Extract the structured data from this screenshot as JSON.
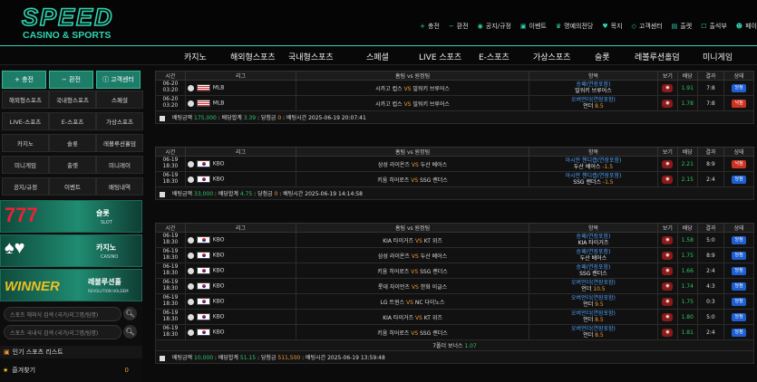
{
  "brand": {
    "logo_main": "SPEED",
    "logo_sub": "CASINO & SPORTS"
  },
  "top_menu": [
    {
      "icon": "+",
      "label": "충전"
    },
    {
      "icon": "−",
      "label": "환전"
    },
    {
      "icon": "◉",
      "label": "공지/규정"
    },
    {
      "icon": "▣",
      "label": "이벤트"
    },
    {
      "icon": "♛",
      "label": "명예의전당"
    },
    {
      "icon": "♥",
      "label": "목지"
    },
    {
      "icon": "◇",
      "label": "고객센터"
    },
    {
      "icon": "▤",
      "label": "출렛"
    },
    {
      "icon": "☐",
      "label": "출석부"
    },
    {
      "icon": "☻",
      "label": "페이"
    }
  ],
  "main_nav": [
    "카지노",
    "해외형스포츠",
    "국내형스포츠",
    "스페셜",
    "LIVE 스포츠",
    "E-스포츠",
    "가상스포츠",
    "슬롯",
    "레볼루션홀덤",
    "미니게임"
  ],
  "sidebar": {
    "buttons": [
      "+ 충전",
      "− 환전",
      "고객센터"
    ],
    "grid": [
      "해외형스포츠",
      "국내형스포츠",
      "스페셜",
      "LIVE-스포츠",
      "E-스포츠",
      "가상스포츠",
      "카지노",
      "슬롯",
      "레볼루션홀덤",
      "미니게임",
      "출렛",
      "미니레이",
      "공지/규정",
      "이벤트",
      "배팅내역"
    ],
    "banners": [
      {
        "img": "777",
        "title": "슬롯",
        "sub": "SLOT"
      },
      {
        "img": "♠♥",
        "title": "카지노",
        "sub": "CASINO"
      },
      {
        "img": "WINNER",
        "title": "레볼루션홀",
        "sub": "REVOLUTION HOLDEM"
      }
    ],
    "search1": "스포츠 해외식 검색 (국가/리그명/팀명)",
    "search2": "스포츠 국내식 검색 (국가/리그명/팀명)",
    "popular_title": "인기 스포츠 리스트",
    "favorites_label": "즐겨찾기",
    "favorites_count": "0"
  },
  "table_headers": [
    "시간",
    "리그",
    "홈팀 vs 원정팀",
    "항목",
    "보기",
    "배당",
    "결과",
    "상태"
  ],
  "bets": [
    {
      "rows": [
        {
          "date": "06-20",
          "time": "03:20",
          "flag": "us",
          "league": "MLB",
          "home": "시카고 컵스",
          "away": "밀워키 브루어스",
          "pick1": "승패(연장포함)",
          "pick2": "밀워키 브루어스",
          "pick2_odds": "",
          "odds": "1.91",
          "result": "7:8",
          "status": "당첨",
          "status_type": "pend"
        },
        {
          "date": "06-20",
          "time": "03:20",
          "flag": "us",
          "league": "MLB",
          "home": "시카고 컵스",
          "away": "밀워키 브루어스",
          "pick1": "오버언더(연장포함)",
          "pick2": "언더",
          "pick2_odds": "8.5",
          "odds": "1.78",
          "result": "7:8",
          "status": "낙첨",
          "status_type": "lose"
        }
      ],
      "summary": {
        "amount_label": "배팅금액",
        "amount": "175,000",
        "odds_label": "배당합계",
        "odds": "3.39",
        "win_label": "당첨금",
        "win": "0",
        "time_label": "배팅시간",
        "time": "2025-06-19 20:07:41"
      }
    },
    {
      "rows": [
        {
          "date": "06-19",
          "time": "18:30",
          "flag": "kr",
          "league": "KBO",
          "home": "삼성 라이온즈",
          "away": "두산 베어스",
          "pick1": "아시안 핸디캡(연장포함)",
          "pick2": "두산 베어스",
          "pick2_odds": "-1.5",
          "odds": "2.21",
          "result": "8:9",
          "status": "낙첨",
          "status_type": "lose"
        },
        {
          "date": "06-19",
          "time": "18:30",
          "flag": "kr",
          "league": "KBO",
          "home": "키움 히어로즈",
          "away": "SSG 랜더스",
          "pick1": "아시안 핸디캡(연장포함)",
          "pick2": "SSG 랜더스",
          "pick2_odds": "-1.5",
          "odds": "2.15",
          "result": "2:4",
          "status": "당첨",
          "status_type": "pend"
        }
      ],
      "summary": {
        "amount_label": "배팅금액",
        "amount": "33,000",
        "odds_label": "배당합계",
        "odds": "4.75",
        "win_label": "당첨금",
        "win": "0",
        "time_label": "배팅시간",
        "time": "2025-06-19 14:14:58"
      }
    },
    {
      "rows": [
        {
          "date": "06-19",
          "time": "18:30",
          "flag": "kr",
          "league": "KBO",
          "home": "KIA 타이거즈",
          "away": "KT 위즈",
          "pick1": "승패(연장포함)",
          "pick2": "KIA 타이거즈",
          "pick2_odds": "",
          "odds": "1.58",
          "result": "5:0",
          "status": "당첨",
          "status_type": "pend"
        },
        {
          "date": "06-19",
          "time": "18:30",
          "flag": "kr",
          "league": "KBO",
          "home": "삼성 라이온즈",
          "away": "두산 베어스",
          "pick1": "승패(연장포함)",
          "pick2": "두산 베어스",
          "pick2_odds": "",
          "odds": "1.75",
          "result": "8:9",
          "status": "당첨",
          "status_type": "pend"
        },
        {
          "date": "06-19",
          "time": "18:30",
          "flag": "kr",
          "league": "KBO",
          "home": "키움 히어로즈",
          "away": "SSG 랜더스",
          "pick1": "승패(연장포함)",
          "pick2": "SSG 랜더스",
          "pick2_odds": "",
          "odds": "1.66",
          "result": "2:4",
          "status": "당첨",
          "status_type": "pend"
        },
        {
          "date": "06-19",
          "time": "18:30",
          "flag": "kr",
          "league": "KBO",
          "home": "롯데 자이언츠",
          "away": "한화 이글스",
          "pick1": "오버언더(연장포함)",
          "pick2": "언더",
          "pick2_odds": "10.5",
          "odds": "1.74",
          "result": "4:3",
          "status": "당첨",
          "status_type": "pend"
        },
        {
          "date": "06-19",
          "time": "18:30",
          "flag": "kr",
          "league": "KBO",
          "home": "LG 트윈스",
          "away": "NC 다이노스",
          "pick1": "오버언더(연장포함)",
          "pick2": "언더",
          "pick2_odds": "9.5",
          "odds": "1.75",
          "result": "0:3",
          "status": "당첨",
          "status_type": "pend"
        },
        {
          "date": "06-19",
          "time": "18:30",
          "flag": "kr",
          "league": "KBO",
          "home": "KIA 타이거즈",
          "away": "KT 위즈",
          "pick1": "오버언더(연장포함)",
          "pick2": "언더",
          "pick2_odds": "8.5",
          "odds": "1.80",
          "result": "5:0",
          "status": "당첨",
          "status_type": "pend"
        },
        {
          "date": "06-19",
          "time": "18:30",
          "flag": "kr",
          "league": "KBO",
          "home": "키움 히어로즈",
          "away": "SSG 랜더스",
          "pick1": "오버언더(연장포함)",
          "pick2": "언더",
          "pick2_odds": "8.5",
          "odds": "1.81",
          "result": "2:4",
          "status": "당첨",
          "status_type": "pend"
        }
      ],
      "bonus": {
        "label": "7폴더 보너스",
        "value": "1.07"
      },
      "summary": {
        "amount_label": "배팅금액",
        "amount": "10,000",
        "odds_label": "배당합계",
        "odds": "51.15",
        "win_label": "당첨금",
        "win": "511,500",
        "time_label": "배팅시간",
        "time": "2025-06-19 13:59:48"
      }
    }
  ],
  "vs_label": "VS",
  "view_label": "보기"
}
